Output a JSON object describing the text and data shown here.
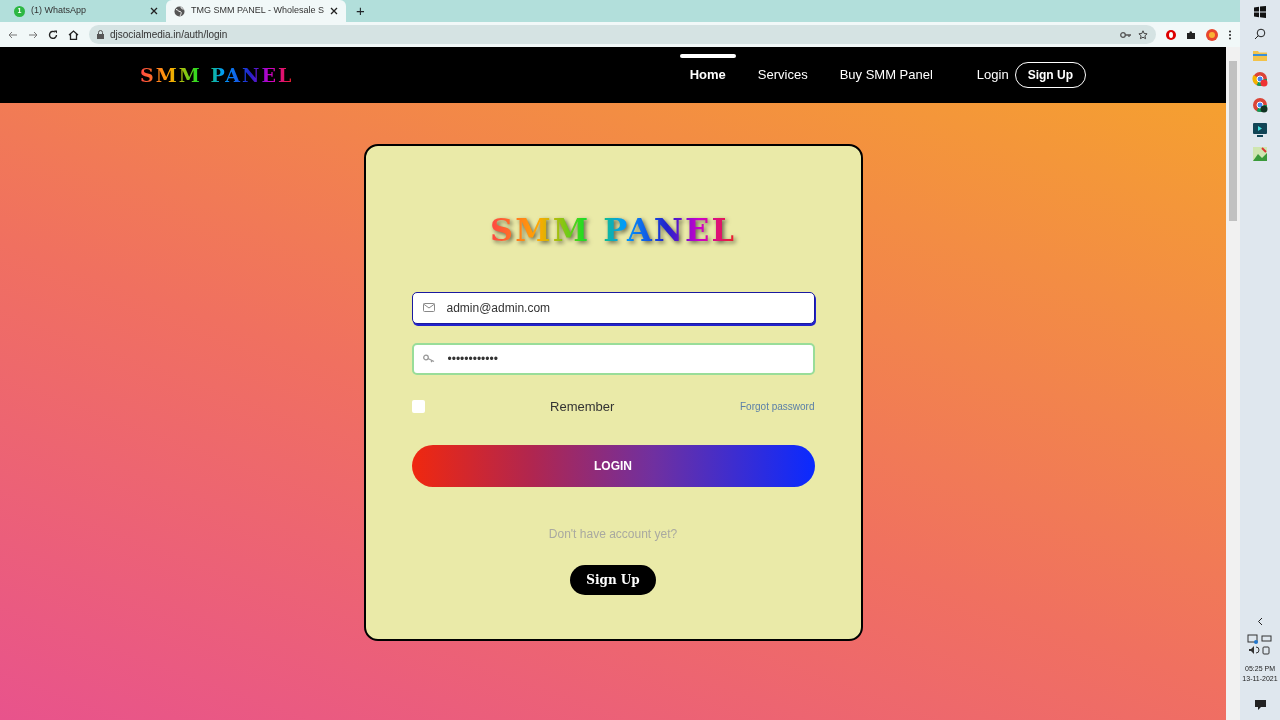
{
  "browser": {
    "tabs": [
      {
        "title": "(1) WhatsApp",
        "badge": "1",
        "selected": false
      },
      {
        "title": "TMG SMM PANEL - Wholesale S",
        "selected": true
      }
    ],
    "new_tab": "+",
    "url": "djsocialmedia.in/auth/login"
  },
  "navbar": {
    "logo": "SMM PANEL",
    "links": [
      {
        "label": "Home",
        "selected": true
      },
      {
        "label": "Services",
        "selected": false
      },
      {
        "label": "Buy SMM Panel",
        "selected": false
      }
    ],
    "login": "Login",
    "signup": "Sign Up"
  },
  "form": {
    "logo": "SMM PANEL",
    "email": {
      "value": "admin@admin.com"
    },
    "password": {
      "value": "••••••••••••"
    },
    "remember": {
      "label": "Remember",
      "checked": false
    },
    "forgot": "Forgot password",
    "submit": "LOGIN",
    "prompt": "Don't have account yet?",
    "signup": "Sign Up"
  },
  "taskbar": {
    "time": "05:25 PM",
    "date": "13-11-2021"
  }
}
